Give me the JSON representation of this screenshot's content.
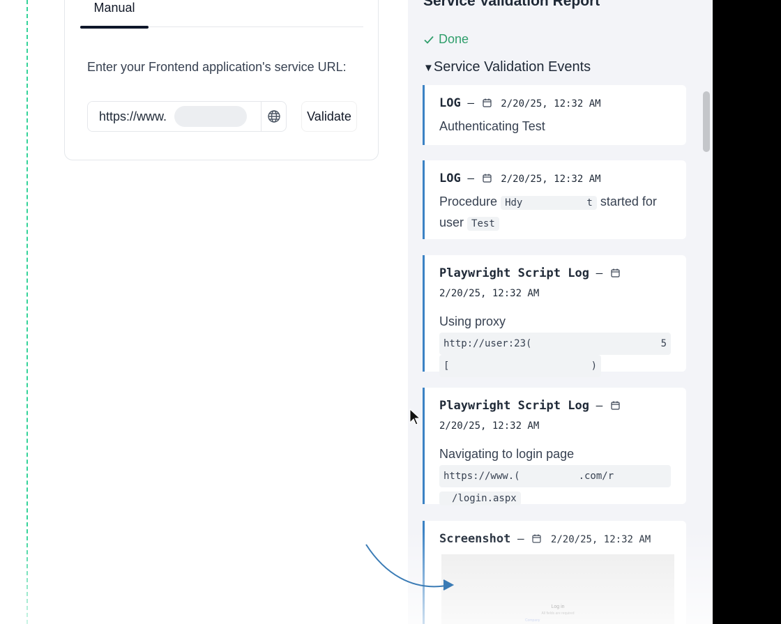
{
  "left": {
    "tab_label": "Manual",
    "prompt": "Enter your Frontend application's service URL:",
    "url_value": "https://www.",
    "globe_icon": "globe-icon",
    "validate_label": "Validate"
  },
  "panel": {
    "title": "Service Validation Report",
    "status": "Done",
    "status_icon": "check-icon",
    "events_header": "Service Validation Events",
    "colors": {
      "accent": "#3b82c4",
      "done": "#2f9e6b",
      "dashed": "#34d399"
    },
    "events": [
      {
        "type": "LOG",
        "sep": "–",
        "time": "2/20/25, 12:32 AM",
        "message": "Authenticating Test"
      },
      {
        "type": "LOG",
        "sep": "–",
        "time": "2/20/25, 12:32 AM",
        "msg_a": "Procedure",
        "code_a": "Hdy",
        "code_a_end": "t",
        "msg_b": "started for",
        "msg_c": "user",
        "code_b": "Test"
      },
      {
        "type": "Playwright Script Log",
        "sep": "–",
        "time": "2/20/25, 12:32 AM",
        "message": "Using proxy",
        "code_1": "http://user:23(",
        "code_1_end": "5",
        "code_2": "[",
        "code_2_end": ")"
      },
      {
        "type": "Playwright Script Log",
        "sep": "–",
        "time": "2/20/25, 12:32 AM",
        "message": "Navigating to login page",
        "code_1": "https://www.(",
        "code_1_mid": ".com/r",
        "code_2": "/login.aspx"
      },
      {
        "type": "Screenshot",
        "sep": "–",
        "time": "2/20/25, 12:32 AM",
        "shot_title": "Log in",
        "shot_sub": "All fields are required",
        "shot_link": "Company"
      }
    ]
  }
}
